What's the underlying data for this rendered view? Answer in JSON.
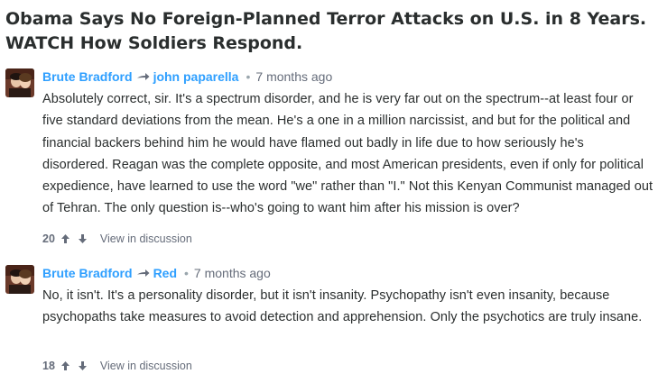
{
  "thread": {
    "title": "Obama Says No Foreign-Planned Terror Attacks on U.S. in 8 Years. WATCH How Soldiers Respond."
  },
  "comments": [
    {
      "author": "Brute Bradford",
      "reply_to": "john paparella",
      "separator": "•",
      "time": "7 months ago",
      "text": "Absolutely correct, sir. It's a spectrum disorder, and he is very far out on the spectrum--at least four or five standard deviations from the mean. He's a one in a million narcissist, and but for the political and financial backers behind him he would have flamed out badly in life due to how seriously he's disordered. Reagan was the complete opposite, and most American presidents, even if only for political expedience, have learned to use the word \"we\" rather than \"I.\" Not this Kenyan Communist managed out of Tehran. The only question is--who's going to want him after his mission is over?",
      "votes": "20",
      "view_label": "View in discussion"
    },
    {
      "author": "Brute Bradford",
      "reply_to": "Red",
      "separator": "•",
      "time": "7 months ago",
      "text": "No, it isn't. It's a personality disorder, but it isn't insanity. Psychopathy isn't even insanity, because psychopaths take measures to avoid detection and apprehension. Only the psychotics are truly insane.",
      "votes": "18",
      "view_label": "View in discussion"
    }
  ],
  "icons": {
    "reply_arrow": "reply-arrow-icon",
    "upvote": "upvote-arrow-icon",
    "downvote": "downvote-arrow-icon"
  },
  "colors": {
    "link": "#2e9fff",
    "text": "#2a2e2e",
    "muted": "#656c7a"
  }
}
